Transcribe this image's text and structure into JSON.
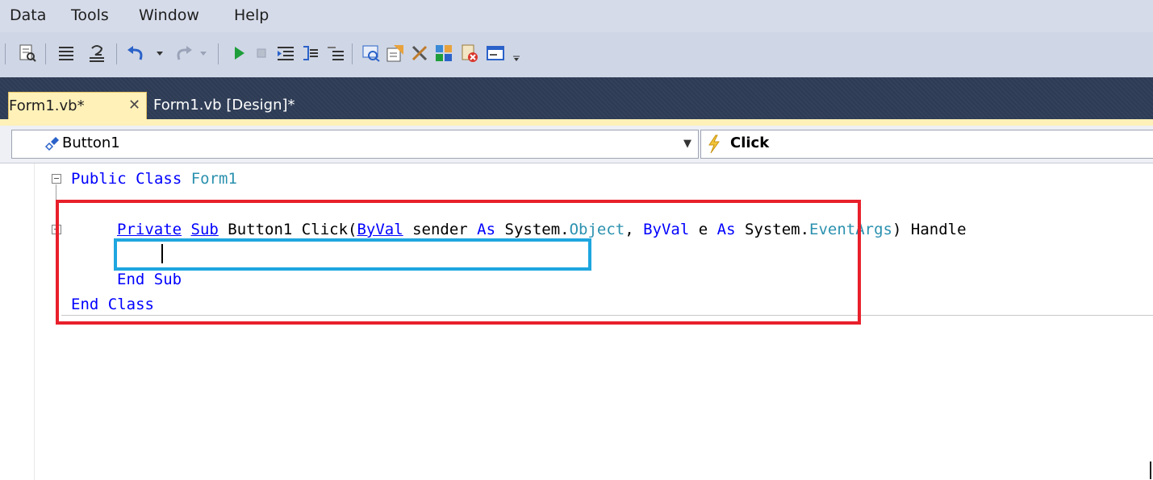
{
  "menubar": {
    "items": [
      "Data",
      "Tools",
      "Window",
      "Help"
    ]
  },
  "toolbar": {
    "icons": [
      "find-in-files-icon",
      "comment-icon",
      "uncomment-icon",
      "undo-icon",
      "undo-dropdown-icon",
      "redo-icon",
      "redo-dropdown-icon",
      "start-debug-icon",
      "stop-debug-icon",
      "indent-icon",
      "outdent-icon",
      "toggle-bookmark-icon",
      "solution-explorer-icon",
      "properties-icon",
      "toolbox-icon",
      "object-browser-icon",
      "error-list-icon",
      "command-window-icon",
      "toolbar-overflow-icon"
    ]
  },
  "tabs": [
    {
      "label": "Form1.vb*",
      "active": true
    },
    {
      "label": "Form1.vb [Design]*",
      "active": false
    }
  ],
  "navbar": {
    "object": "Button1",
    "event": "Click"
  },
  "code": {
    "class_open_kw": "Public Class",
    "class_name": "Form1",
    "sub_private": "Private",
    "sub_kw": "Sub",
    "sub_name": " Button1 Click(",
    "byval1": "ByVal",
    "sender": " sender ",
    "as1": "As",
    "system1": " System.",
    "object_type": "Object",
    "comma": ", ",
    "byval2": "ByVal",
    "e": " e ",
    "as2": "As",
    "system2": " System.",
    "eventargs_type": "EventArgs",
    "handles": ") Handle",
    "end_sub": "End Sub",
    "end_class": "End Class"
  },
  "colors": {
    "keyword": "#0000ff",
    "type": "#2b91af",
    "red_highlight": "#e8202b",
    "blue_highlight": "#1ea6df",
    "tab_active": "#fff1b8"
  }
}
